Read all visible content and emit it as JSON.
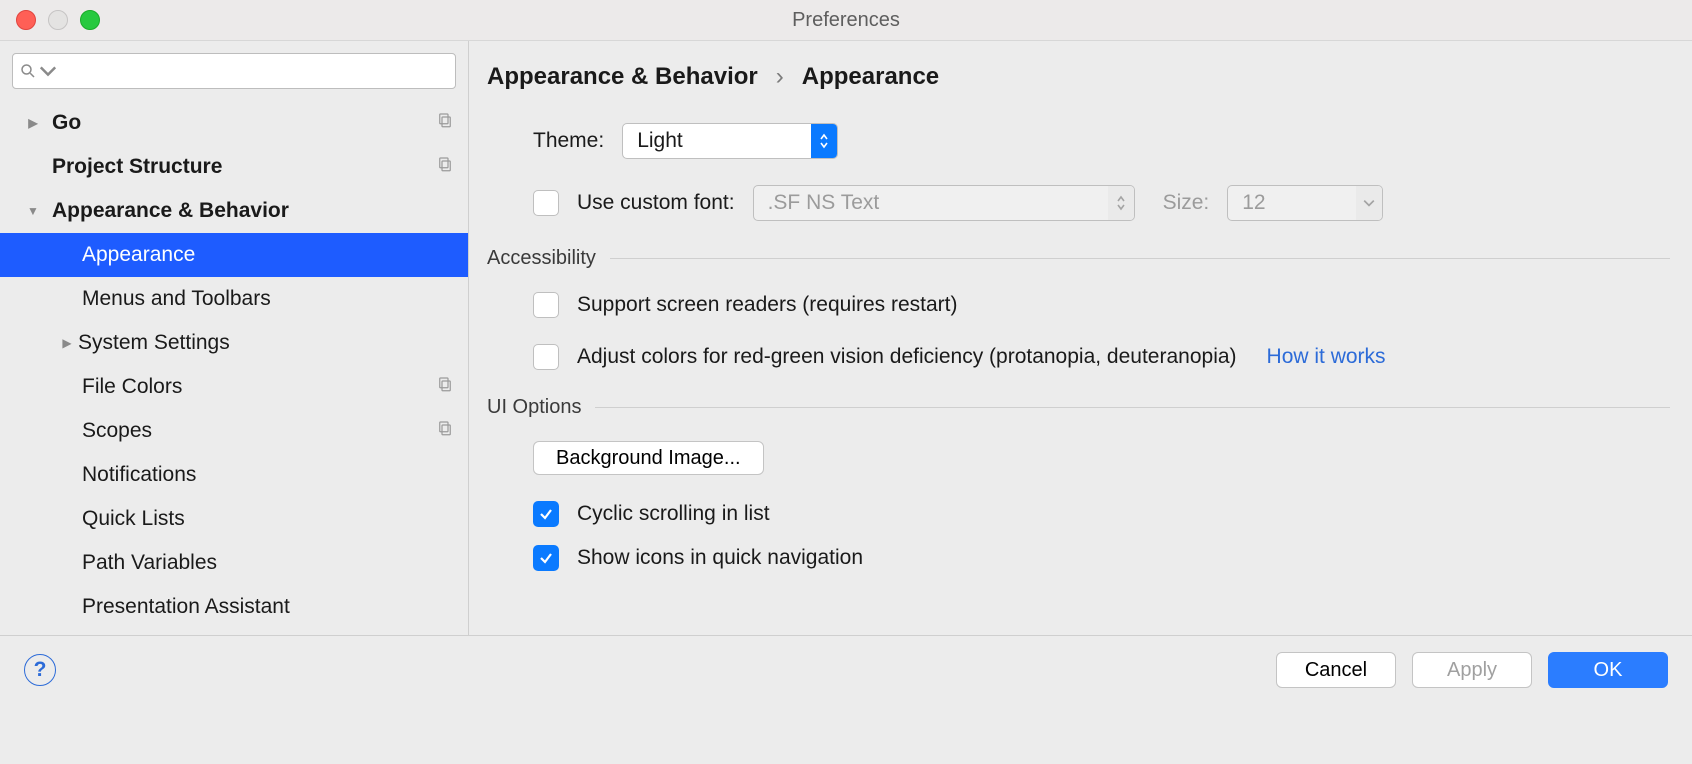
{
  "window": {
    "title": "Preferences"
  },
  "sidebar": {
    "items": [
      {
        "label": "Go",
        "level": 0,
        "arrow": "right",
        "hasCopy": true
      },
      {
        "label": "Project Structure",
        "level": 0,
        "arrow": "",
        "hasCopy": true
      },
      {
        "label": "Appearance & Behavior",
        "level": 0,
        "arrow": "down",
        "hasCopy": false
      },
      {
        "label": "Appearance",
        "level": 1,
        "selected": true
      },
      {
        "label": "Menus and Toolbars",
        "level": 1
      },
      {
        "label": "System Settings",
        "level": 1,
        "arrow": "right"
      },
      {
        "label": "File Colors",
        "level": 1,
        "hasCopy": true
      },
      {
        "label": "Scopes",
        "level": 1,
        "hasCopy": true
      },
      {
        "label": "Notifications",
        "level": 1
      },
      {
        "label": "Quick Lists",
        "level": 1
      },
      {
        "label": "Path Variables",
        "level": 1
      },
      {
        "label": "Presentation Assistant",
        "level": 1
      }
    ]
  },
  "breadcrumb": {
    "part1": "Appearance & Behavior",
    "sep": "›",
    "part2": "Appearance"
  },
  "form": {
    "theme_label": "Theme:",
    "theme_value": "Light",
    "custom_font_label": "Use custom font:",
    "custom_font_value": ".SF NS Text",
    "size_label": "Size:",
    "size_value": "12"
  },
  "accessibility": {
    "title": "Accessibility",
    "screen_readers": "Support screen readers (requires restart)",
    "color_adjust": "Adjust colors for red-green vision deficiency (protanopia, deuteranopia)",
    "how_it_works": "How it works"
  },
  "ui_options": {
    "title": "UI Options",
    "background_btn": "Background Image...",
    "cyclic": "Cyclic scrolling in list",
    "show_icons": "Show icons in quick navigation"
  },
  "footer": {
    "cancel": "Cancel",
    "apply": "Apply",
    "ok": "OK"
  }
}
